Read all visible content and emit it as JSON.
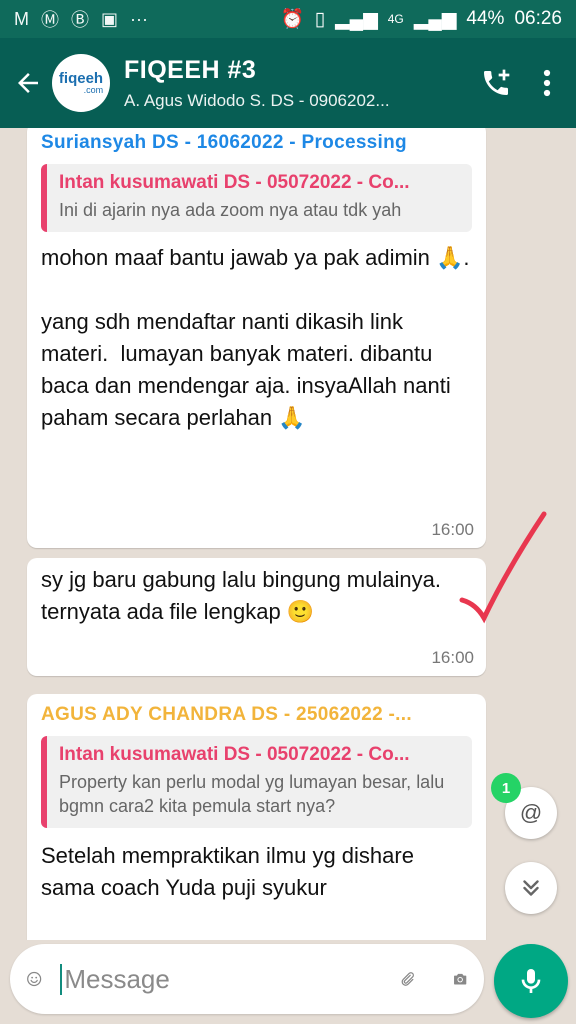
{
  "status_bar": {
    "left_icons": [
      "gmail-icon",
      "messenger-icon",
      "bbm-icon",
      "gallery-icon",
      "more-icon"
    ],
    "network": "4G",
    "battery": "44%",
    "time": "06:26"
  },
  "header": {
    "avatar_text": "fiqeeh",
    "avatar_subtext": ".com",
    "title": "FIQEEH #3",
    "subtitle": "A. Agus Widodo S. DS - 0906202..."
  },
  "messages": [
    {
      "sender": "Suriansyah DS - 16062022 - Processing",
      "sender_color": "#1e88e5",
      "quote_author": "Intan kusumawati DS - 05072022 - Co...",
      "quote_text": "Ini di ajarin nya ada zoom nya atau tdk yah",
      "text": "mohon maaf bantu jawab ya pak adimin 🙏.\n\nyang sdh mendaftar nanti dikasih link materi.  lumayan banyak materi. dibantu baca dan mendengar aja. insyaAllah nanti paham secara perlahan 🙏",
      "time": "16:00"
    },
    {
      "text": "sy jg baru gabung lalu bingung mulainya.   ternyata ada file lengkap 🙂",
      "time": "16:00"
    },
    {
      "sender": "AGUS ADY CHANDRA DS - 25062022 -...",
      "sender_color": "#f2b43b",
      "quote_author": "Intan kusumawati DS - 05072022 - Co...",
      "quote_text": "Property kan perlu modal yg lumayan besar, lalu bgmn cara2 kita pemula start nya?",
      "text": "Setelah mempraktikan ilmu yg dishare sama coach Yuda puji syukur"
    }
  ],
  "mention_badge": "1",
  "mention_symbol": "@",
  "input": {
    "placeholder": "Message"
  },
  "colors": {
    "header": "#075e54",
    "quote_accent": "#e8416d",
    "mic": "#00a884",
    "checkmark": "#e8374f"
  }
}
